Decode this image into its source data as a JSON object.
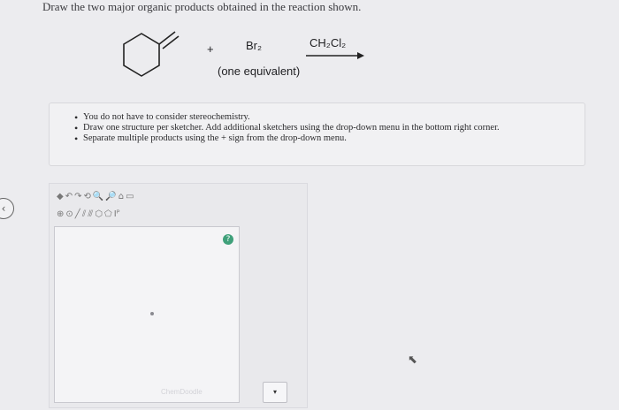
{
  "question": "Draw the two major organic products obtained in the reaction shown.",
  "reaction": {
    "plus": "+",
    "reagent": "Br₂",
    "reagent_note": "(one equivalent)",
    "solvent": "CH₂Cl₂"
  },
  "instructions": [
    "You do not have to consider stereochemistry.",
    "Draw one structure per sketcher. Add additional sketchers using the drop-down menu in the bottom right corner.",
    "Separate multiple products using the + sign from the drop-down menu."
  ],
  "sketcher": {
    "toolbar_row1_icons": [
      "eraser-icon",
      "undo-icon",
      "redo-icon",
      "zoom-in-icon",
      "zoom-out-icon",
      "clean-icon",
      "paste-icon"
    ],
    "toolbar_row2_icons": [
      "charge-icon",
      "atom-icon",
      "single-bond-icon",
      "double-bond-icon",
      "triple-bond-icon",
      "ring-icon",
      "label-icon"
    ],
    "help_label": "?",
    "watermark": "ChemDoodle"
  },
  "dropdown_label": "▾",
  "nav_arrow": "‹"
}
